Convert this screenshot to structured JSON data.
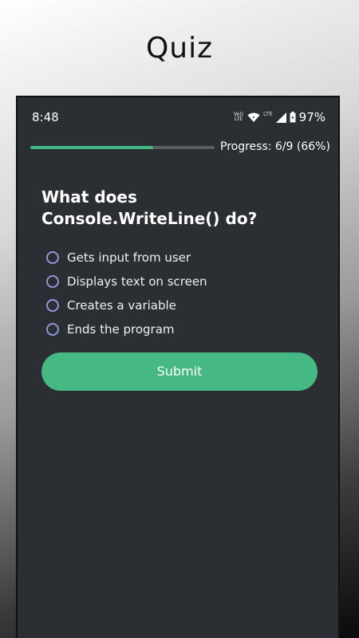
{
  "header": {
    "title": "Quiz"
  },
  "status_bar": {
    "time": "8:48",
    "volte_top": "Vo))",
    "volte_bottom": "LTE",
    "lte_label": "LTE",
    "battery_percent": "97%",
    "icons": [
      "wifi-icon",
      "signal-icon",
      "battery-icon"
    ]
  },
  "progress": {
    "text": "Progress: 6/9 (66%)",
    "fraction": 0.667
  },
  "question": {
    "text": "What does Console.WriteLine() do?"
  },
  "options": [
    {
      "label": "Gets input from user"
    },
    {
      "label": "Displays text on screen"
    },
    {
      "label": "Creates a variable"
    },
    {
      "label": "Ends the program"
    }
  ],
  "submit": {
    "label": "Submit"
  },
  "colors": {
    "accent": "#45b884",
    "radio": "#8e96d8",
    "panel": "#2b2e33"
  }
}
